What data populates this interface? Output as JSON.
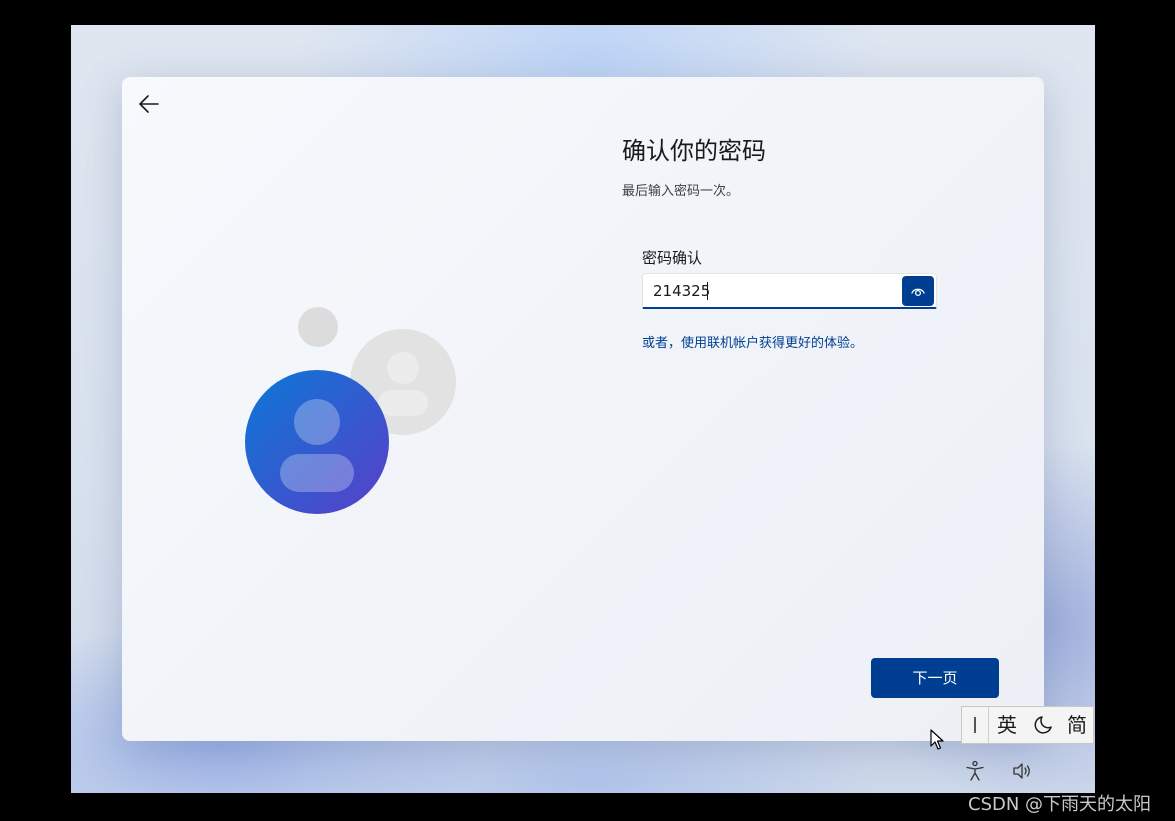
{
  "oobe": {
    "title": "确认你的密码",
    "subtitle": "最后输入密码一次。",
    "field_label": "密码确认",
    "password_value": "214325",
    "alt_link": "或者，使用联机帐户获得更好的体验。",
    "next_label": "下一页",
    "accent_color": "#003e92"
  },
  "ime": {
    "lang_label": "英",
    "mode_label": "简"
  },
  "icons": {
    "back": "back-arrow-icon",
    "reveal": "eye-icon",
    "illustration": "user-avatars-icon",
    "moon": "moon-icon",
    "accessibility": "accessibility-icon",
    "volume": "volume-icon"
  },
  "watermark": "CSDN @下雨天的太阳"
}
